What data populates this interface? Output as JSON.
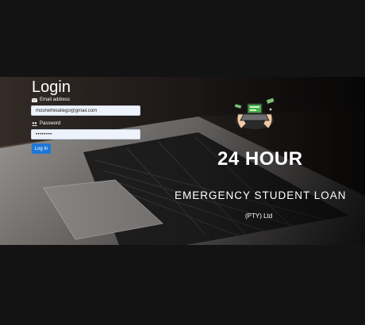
{
  "login": {
    "title": "Login",
    "email_label": "Email address",
    "email_value": "moshethikatlego@gmail.com",
    "password_label": "Password",
    "password_value": "password",
    "button_label": "Log In"
  },
  "brand": {
    "logo_icon": "student-laptop-money-icon",
    "headline": "24 HOUR",
    "subheadline": "EMERGENCY STUDENT LOAN",
    "company_suffix": "(PTY) Ltd"
  },
  "colors": {
    "button": "#1d78d8",
    "page_background": "#131313",
    "text": "#ffffff"
  }
}
